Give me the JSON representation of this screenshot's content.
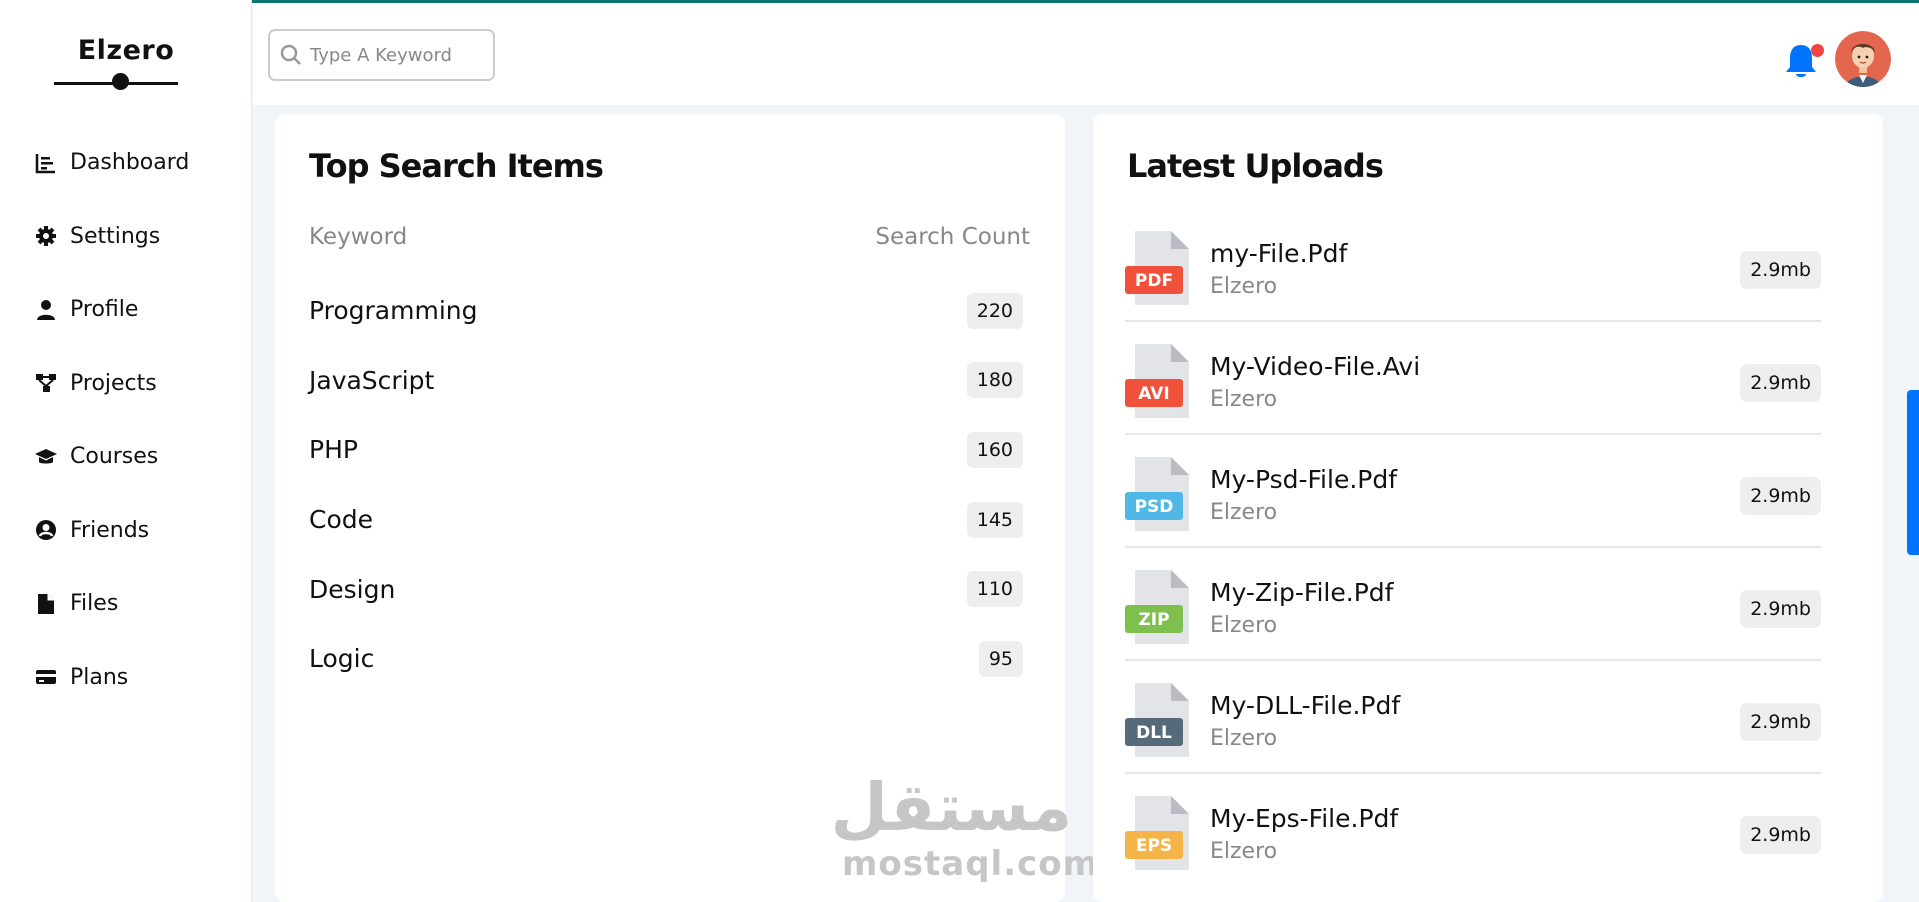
{
  "brand": {
    "name": "Elzero"
  },
  "sidebar": {
    "items": [
      {
        "label": "Dashboard",
        "icon": "chart-icon"
      },
      {
        "label": "Settings",
        "icon": "gear-icon"
      },
      {
        "label": "Profile",
        "icon": "user-icon"
      },
      {
        "label": "Projects",
        "icon": "diagram-icon"
      },
      {
        "label": "Courses",
        "icon": "graduation-cap-icon"
      },
      {
        "label": "Friends",
        "icon": "user-circle-icon"
      },
      {
        "label": "Files",
        "icon": "file-icon"
      },
      {
        "label": "Plans",
        "icon": "credit-card-icon"
      }
    ]
  },
  "header": {
    "search_placeholder": "Type A Keyword",
    "notification_icon": "bell-icon",
    "has_notification": true
  },
  "top_search": {
    "title": "Top Search Items",
    "col_keyword": "Keyword",
    "col_count": "Search Count",
    "rows": [
      {
        "keyword": "Programming",
        "count": "220"
      },
      {
        "keyword": "JavaScript",
        "count": "180"
      },
      {
        "keyword": "PHP",
        "count": "160"
      },
      {
        "keyword": "Code",
        "count": "145"
      },
      {
        "keyword": "Design",
        "count": "110"
      },
      {
        "keyword": "Logic",
        "count": "95"
      }
    ]
  },
  "latest_uploads": {
    "title": "Latest Uploads",
    "files": [
      {
        "type": "PDF",
        "name": "my-File.Pdf",
        "owner": "Elzero",
        "size": "2.9mb",
        "color": "#f0513a"
      },
      {
        "type": "AVI",
        "name": "My-Video-File.Avi",
        "owner": "Elzero",
        "size": "2.9mb",
        "color": "#f0513a"
      },
      {
        "type": "PSD",
        "name": "My-Psd-File.Pdf",
        "owner": "Elzero",
        "size": "2.9mb",
        "color": "#4fb8e6"
      },
      {
        "type": "ZIP",
        "name": "My-Zip-File.Pdf",
        "owner": "Elzero",
        "size": "2.9mb",
        "color": "#7fbf4d"
      },
      {
        "type": "DLL",
        "name": "My-DLL-File.Pdf",
        "owner": "Elzero",
        "size": "2.9mb",
        "color": "#566a7a"
      },
      {
        "type": "EPS",
        "name": "My-Eps-File.Pdf",
        "owner": "Elzero",
        "size": "2.9mb",
        "color": "#f5b447"
      }
    ]
  },
  "watermark": {
    "arabic": "مستقل",
    "latin": "mostaql.com"
  },
  "colors": {
    "accent": "#0074ff",
    "notification": "#ef4444",
    "topline": "#0f766e"
  }
}
